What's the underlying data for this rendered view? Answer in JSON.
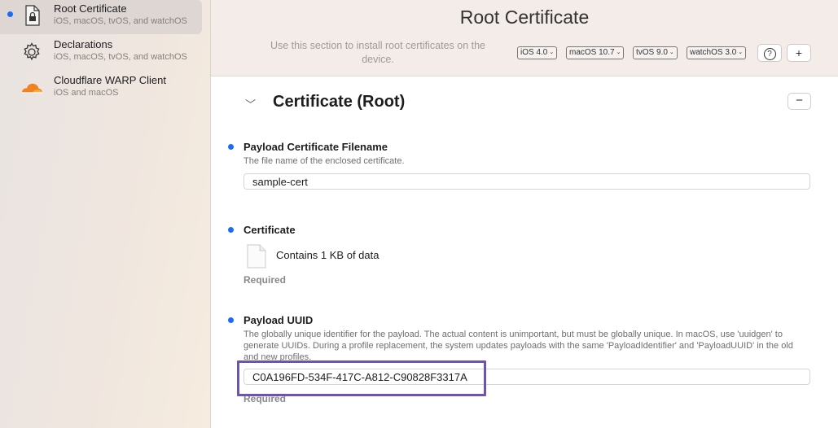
{
  "sidebar": {
    "items": [
      {
        "title": "Root Certificate",
        "subtitle": "iOS, macOS, tvOS, and watchOS",
        "icon": "lock-document-icon",
        "selected": true
      },
      {
        "title": "Declarations",
        "subtitle": "iOS, macOS, tvOS, and watchOS",
        "icon": "gear-icon",
        "selected": false
      },
      {
        "title": "Cloudflare WARP Client",
        "subtitle": "iOS and macOS",
        "icon": "cloudflare-logo-icon",
        "selected": false
      }
    ]
  },
  "header": {
    "title": "Root Certificate",
    "description": "Use this section to install root certificates on the device.",
    "badges": [
      {
        "os": "iOS",
        "version": "4.0"
      },
      {
        "os": "macOS",
        "version": "10.7"
      },
      {
        "os": "tvOS",
        "version": "9.0"
      },
      {
        "os": "watchOS",
        "version": "3.0"
      }
    ],
    "help_label": "?",
    "add_label": "+"
  },
  "section": {
    "title": "Certificate (Root)",
    "remove_label": "−"
  },
  "fields": {
    "filename": {
      "label": "Payload Certificate Filename",
      "description": "The file name of the enclosed certificate.",
      "value": "sample-cert"
    },
    "certificate": {
      "label": "Certificate",
      "file_text": "Contains 1 KB of data",
      "required": "Required"
    },
    "uuid": {
      "label": "Payload UUID",
      "description": "The globally unique identifier for the payload. The actual content is unimportant, but must be globally unique. In macOS, use 'uuidgen' to generate UUIDs. During a profile replacement, the system updates payloads with the same 'PayloadIdentifier' and 'PayloadUUID' in the old and new profiles.",
      "value": "C0A196FD-534F-417C-A812-C90828F3317A",
      "required": "Required"
    }
  },
  "colors": {
    "accent": "#1a6cf2",
    "highlight": "#7052b0",
    "cloudflare": "#f48120"
  }
}
